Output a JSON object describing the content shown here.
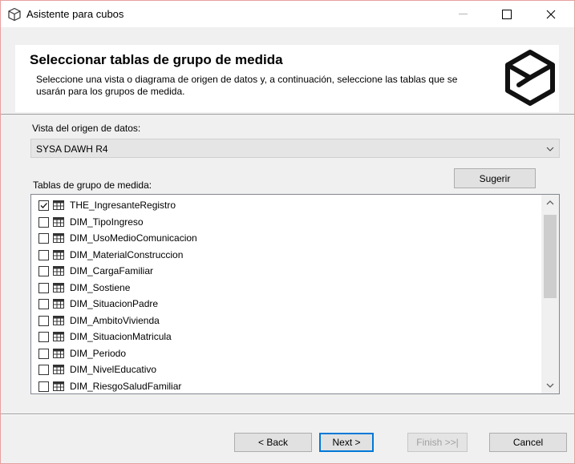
{
  "window": {
    "title": "Asistente para cubos",
    "icon": "cube-icon"
  },
  "header": {
    "title": "Seleccionar tablas de grupo de medida",
    "description": "Seleccione una vista o diagrama de origen de datos y, a continuación, seleccione las tablas que se usarán para los grupos de medida.",
    "logo": "cube-logo-icon"
  },
  "data_source": {
    "label": "Vista del origen de datos:",
    "selected": "SYSA DAWH R4"
  },
  "tables": {
    "label": "Tablas de grupo de medida:",
    "suggest_label": "Sugerir",
    "items": [
      {
        "label": "THE_IngresanteRegistro",
        "checked": true
      },
      {
        "label": "DIM_TipoIngreso",
        "checked": false
      },
      {
        "label": "DIM_UsoMedioComunicacion",
        "checked": false
      },
      {
        "label": "DIM_MaterialConstruccion",
        "checked": false
      },
      {
        "label": "DIM_CargaFamiliar",
        "checked": false
      },
      {
        "label": "DIM_Sostiene",
        "checked": false
      },
      {
        "label": "DIM_SituacionPadre",
        "checked": false
      },
      {
        "label": "DIM_AmbitoVivienda",
        "checked": false
      },
      {
        "label": "DIM_SituacionMatricula",
        "checked": false
      },
      {
        "label": "DIM_Periodo",
        "checked": false
      },
      {
        "label": "DIM_NivelEducativo",
        "checked": false
      },
      {
        "label": "DIM_RiesgoSaludFamiliar",
        "checked": false
      }
    ]
  },
  "footer": {
    "back_label": "< Back",
    "next_label": "Next >",
    "finish_label": "Finish >>|",
    "cancel_label": "Cancel"
  },
  "colors": {
    "accent": "#0078d7",
    "window_bg": "#f0f0f0"
  }
}
